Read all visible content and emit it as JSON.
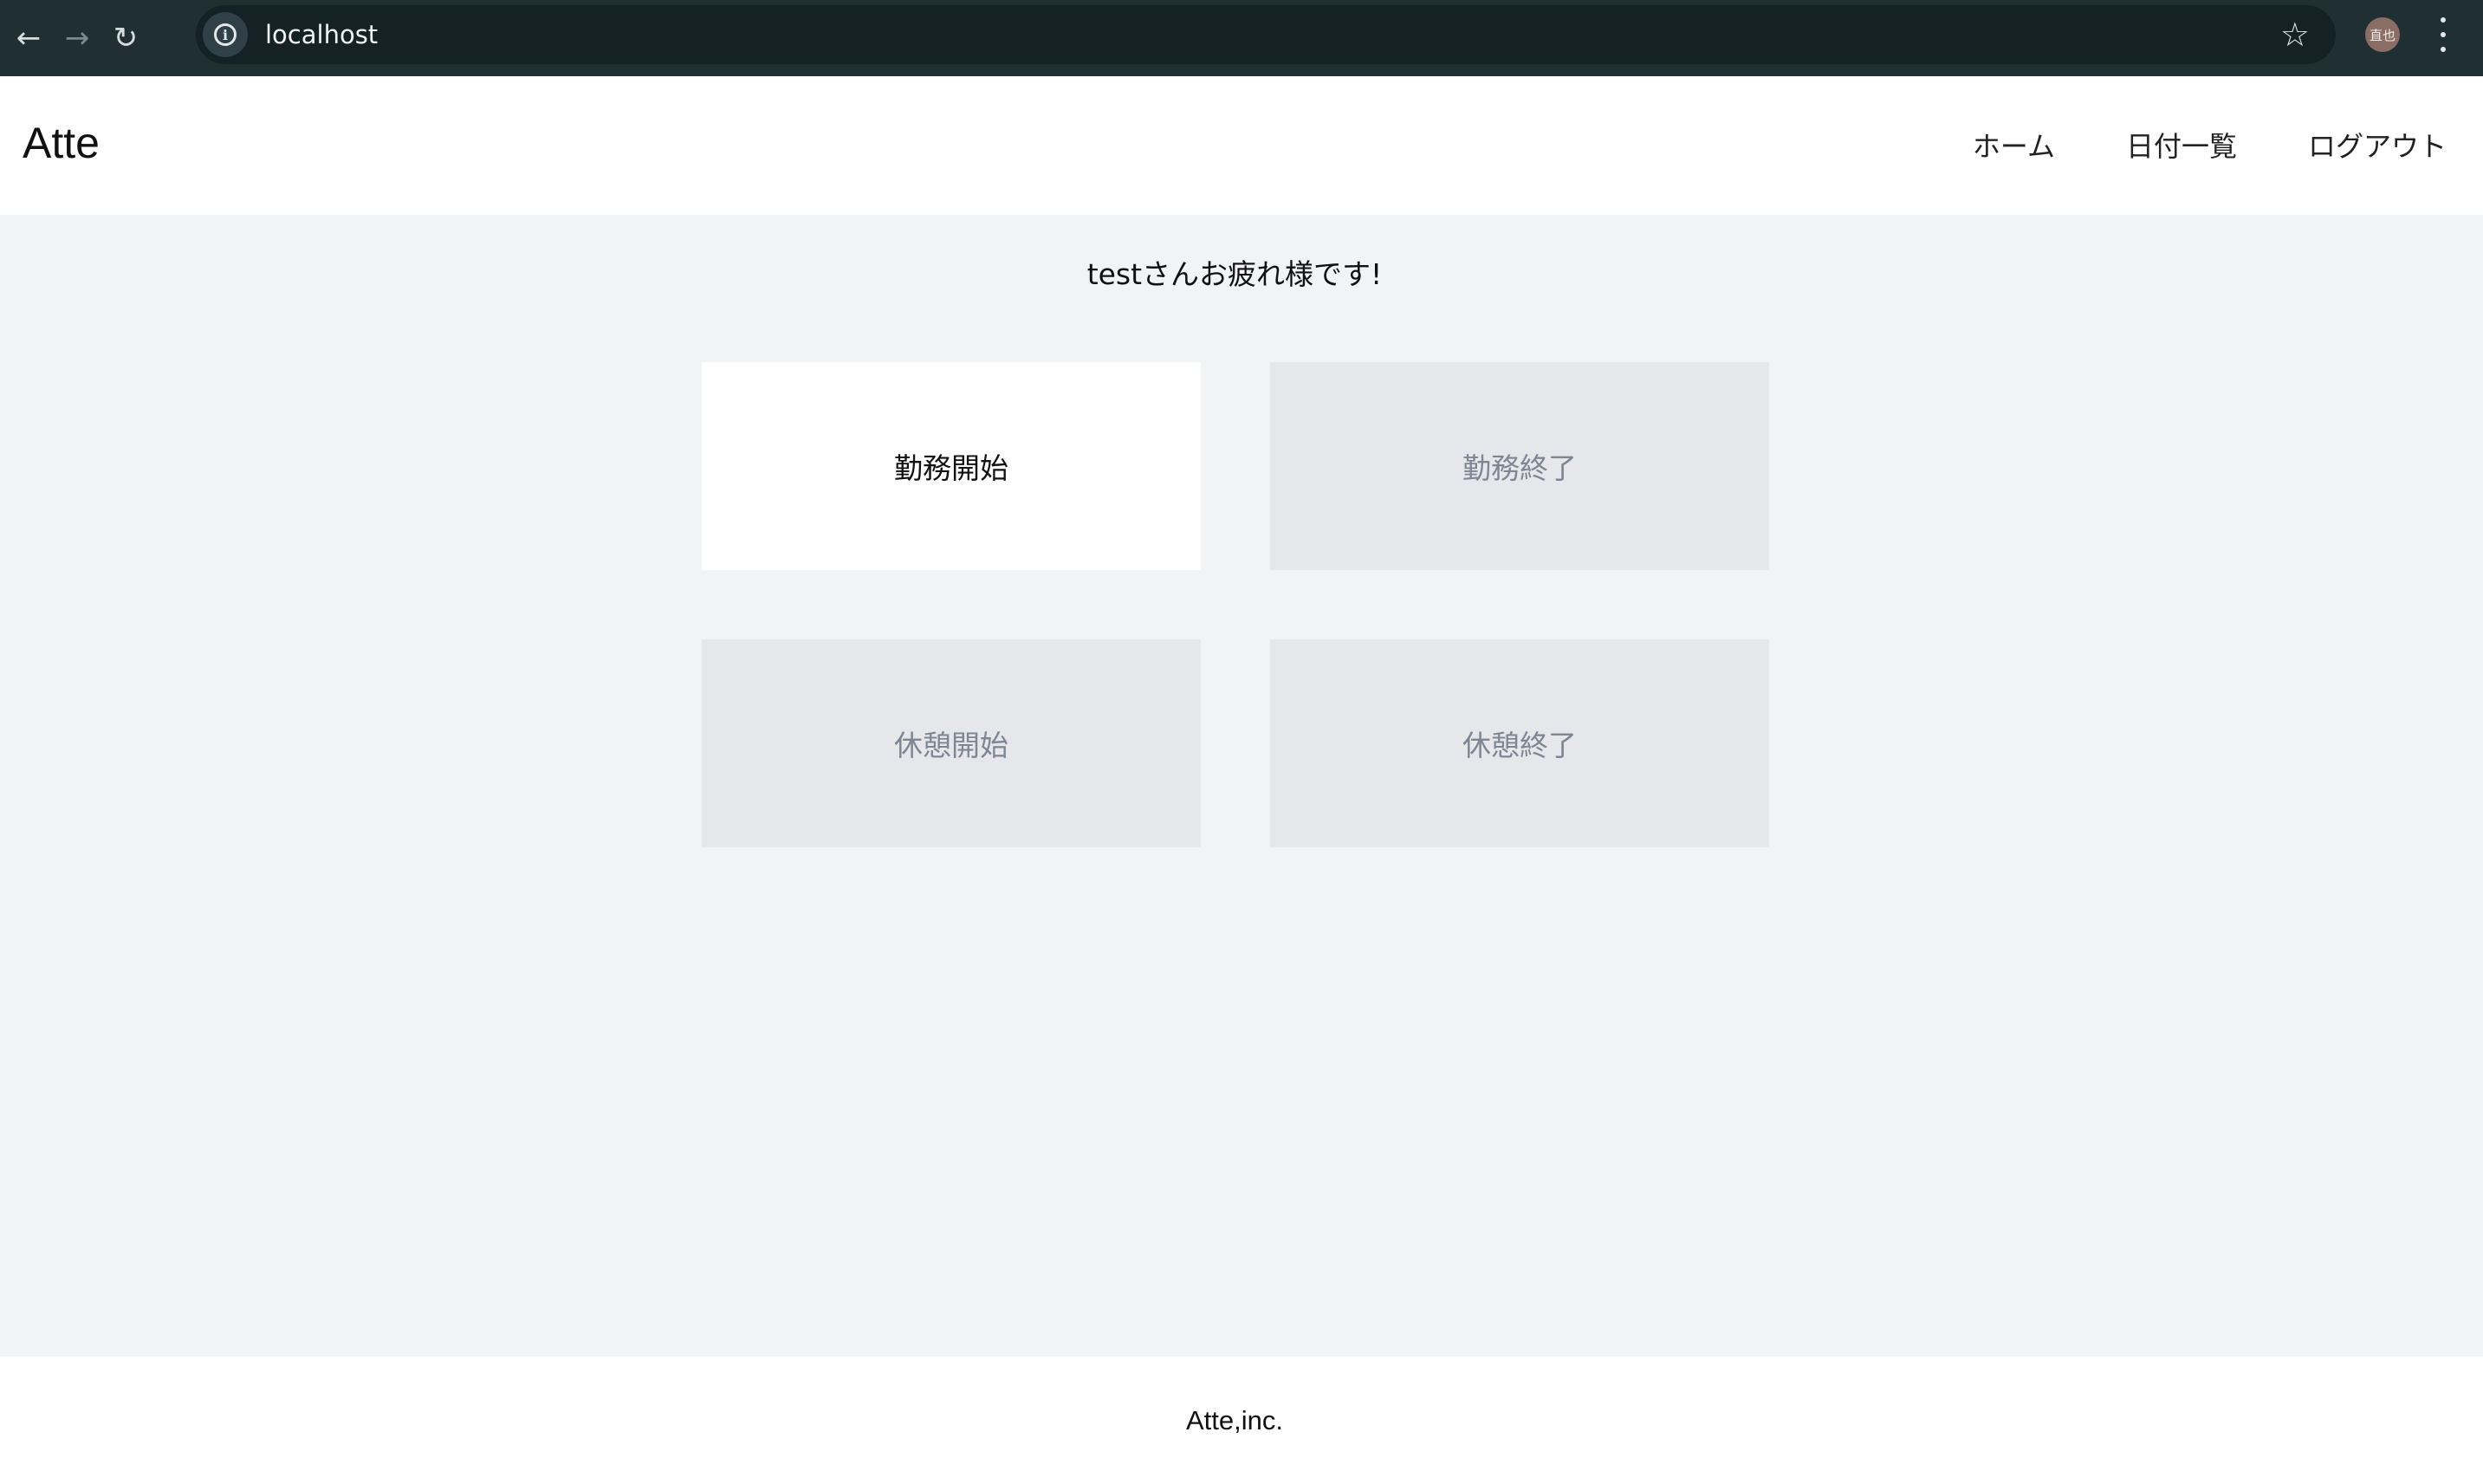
{
  "browser": {
    "url": "localhost",
    "profile_initials": "直也",
    "icons": {
      "back": "arrow-left-icon",
      "forward": "arrow-right-icon",
      "reload": "reload-icon",
      "site_info": "info-icon",
      "bookmark": "star-icon",
      "menu": "kebab-menu-icon"
    }
  },
  "header": {
    "logo": "Atte",
    "nav": [
      {
        "label": "ホーム"
      },
      {
        "label": "日付一覧"
      },
      {
        "label": "ログアウト"
      }
    ]
  },
  "main": {
    "greeting": "testさんお疲れ様です!",
    "buttons": [
      {
        "label": "勤務開始",
        "enabled": true
      },
      {
        "label": "勤務終了",
        "enabled": false
      },
      {
        "label": "休憩開始",
        "enabled": false
      },
      {
        "label": "休憩終了",
        "enabled": false
      }
    ]
  },
  "footer": {
    "text": "Atte,inc."
  },
  "colors": {
    "chrome_bg": "#1f2f33",
    "page_bg": "#f2f3f5",
    "active_button_bg": "#ffffff",
    "disabled_button_bg": "#e6e7ea",
    "disabled_text": "#7e8694"
  }
}
